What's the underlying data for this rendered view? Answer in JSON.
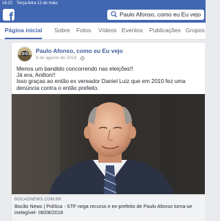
{
  "status_bar": {
    "time": "16:22",
    "date": "Terça-feira 12 de maio"
  },
  "navbar": {
    "logo_letter": "f",
    "search_value": "Paulo Afonso, como eu Eu vejo"
  },
  "tabs": [
    {
      "label": "Página inicial",
      "active": true
    },
    {
      "label": "Sobre"
    },
    {
      "label": "Fotos"
    },
    {
      "label": "Vídeos"
    },
    {
      "label": "Eventos"
    },
    {
      "label": "Publicações"
    },
    {
      "label": "Grupos"
    }
  ],
  "post": {
    "author": "Paulo Afonso, como eu Eu vejo",
    "date": "8 de agosto de 2018 ·",
    "text_lines": [
      "Menos um bandido concorrendo nas eleições!!",
      "Já era, Anilton!!",
      "Isso graças ao então ex vereador Daniel Luiz que em 2010 fez uma",
      "denúncia contra o então prefeito."
    ],
    "link_preview": {
      "domain": "BOCAONEWS.COM.BR",
      "title": "Bocão News | Política - STF nega recurso e ex-prefeito de Paulo Afonso torna-se inelegível- 08/08/2018"
    }
  },
  "colors": {
    "brand": "#4267b2",
    "link": "#385898",
    "text": "#1d2129",
    "muted": "#90949c"
  }
}
